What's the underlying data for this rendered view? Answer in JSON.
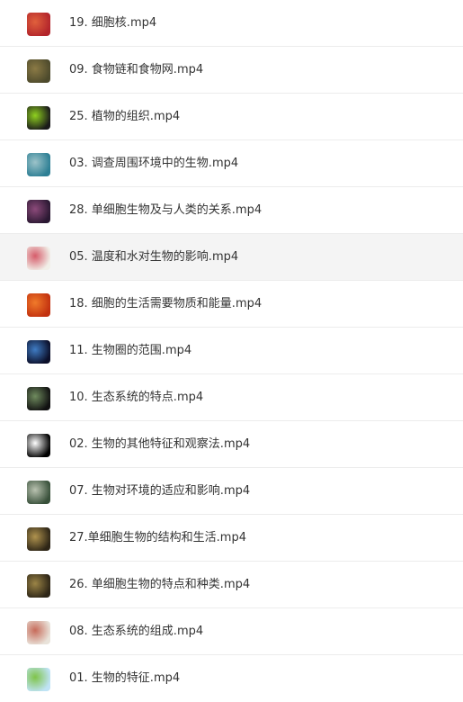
{
  "files": [
    {
      "name": "19. 细胞核.mp4",
      "thumb_icon": "cell-nucleus-thumbnail",
      "colors": [
        "#b3252b",
        "#e0603c"
      ]
    },
    {
      "name": "09. 食物链和食物网.mp4",
      "thumb_icon": "food-web-thumbnail",
      "colors": [
        "#4d4a2c",
        "#8b7a45"
      ]
    },
    {
      "name": "25. 植物的组织.mp4",
      "thumb_icon": "plant-tissue-thumbnail",
      "colors": [
        "#1a1a1a",
        "#8fd11f"
      ]
    },
    {
      "name": "03. 调查周围环境中的生物.mp4",
      "thumb_icon": "environment-survey-thumbnail",
      "colors": [
        "#2d7f94",
        "#9cc3c9"
      ]
    },
    {
      "name": "28. 单细胞生物及与人类的关系.mp4",
      "thumb_icon": "single-cell-human-thumbnail",
      "colors": [
        "#2a1832",
        "#8c4a7a"
      ]
    },
    {
      "name": "05. 温度和水对生物的影响.mp4",
      "thumb_icon": "temperature-water-thumbnail",
      "colors": [
        "#f1efe8",
        "#d65c6a"
      ]
    },
    {
      "name": "18. 细胞的生活需要物质和能量.mp4",
      "thumb_icon": "cell-energy-thumbnail",
      "colors": [
        "#c2310f",
        "#f07a2a"
      ]
    },
    {
      "name": "11. 生物圈的范围.mp4",
      "thumb_icon": "biosphere-earth-thumbnail",
      "colors": [
        "#0b0f2a",
        "#3f7cc4"
      ]
    },
    {
      "name": "10. 生态系统的特点.mp4",
      "thumb_icon": "ecosystem-features-thumbnail",
      "colors": [
        "#111111",
        "#6f8b5e"
      ]
    },
    {
      "name": "02. 生物的其他特征和观察法.mp4",
      "thumb_icon": "observation-method-thumbnail",
      "colors": [
        "#000000",
        "#ffffff"
      ]
    },
    {
      "name": "07. 生物对环境的适应和影响.mp4",
      "thumb_icon": "adaptation-thumbnail",
      "colors": [
        "#38503a",
        "#b9c2b0"
      ]
    },
    {
      "name": "27.单细胞生物的结构和生活.mp4",
      "thumb_icon": "single-cell-structure-thumbnail",
      "colors": [
        "#2d2516",
        "#b0934e"
      ]
    },
    {
      "name": "26. 单细胞生物的特点和种类.mp4",
      "thumb_icon": "single-cell-types-thumbnail",
      "colors": [
        "#2d2516",
        "#9b8446"
      ]
    },
    {
      "name": "08. 生态系统的组成.mp4",
      "thumb_icon": "ecosystem-composition-thumbnail",
      "colors": [
        "#e9e3da",
        "#c76b5a"
      ]
    },
    {
      "name": "01. 生物的特征.mp4",
      "thumb_icon": "living-features-thumbnail",
      "colors": [
        "#bfe3f5",
        "#7fc449"
      ]
    }
  ],
  "selected_index": 5
}
